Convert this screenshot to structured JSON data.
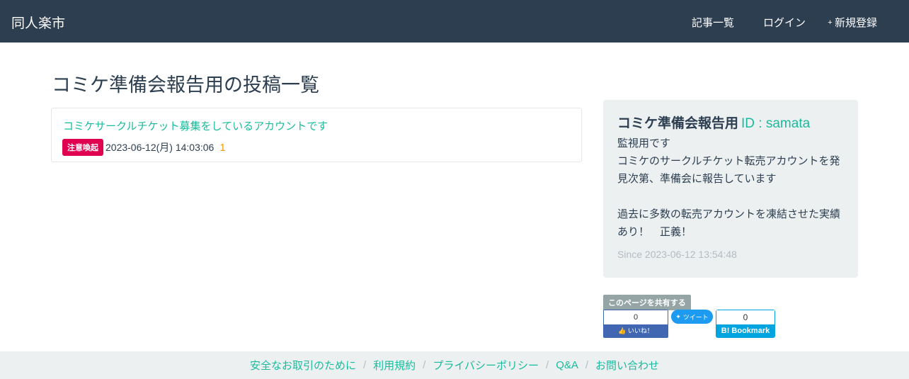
{
  "navbar": {
    "brand": "同人楽市",
    "items": [
      {
        "icon": "",
        "label": "記事一覧"
      },
      {
        "icon": "",
        "label": "ログイン"
      },
      {
        "icon": "+",
        "label": "新規登録"
      }
    ]
  },
  "main": {
    "title": "コミケ準備会報告用の投稿一覧",
    "posts": [
      {
        "title": "コミケサークルチケット募集をしているアカウントです",
        "badge": "注意喚起",
        "datetime": "2023-06-12(月) 14:03:06",
        "comment_icon": "",
        "comment_count": "1"
      }
    ]
  },
  "profile": {
    "icon": "",
    "name": "コミケ準備会報告用",
    "id": "ID : samata",
    "bio": "監視用です\nコミケのサークルチケット転売アカウントを発見次第、準備会に報告しています\n\n過去に多数の転売アカウントを凍結させた実績あり！　正義！",
    "since_icon": "",
    "since": "Since 2023-06-12 13:54:48"
  },
  "share": {
    "label": "このページを共有する",
    "facebook": {
      "count": "0",
      "label": "いいね！"
    },
    "twitter": {
      "label": "ツイート"
    },
    "hatena": {
      "count": "0",
      "label": "B! Bookmark"
    }
  },
  "footer": {
    "links": [
      "安全なお取引のために",
      "利用規約",
      "プライバシーポリシー",
      "Q&A",
      "お問い合わせ"
    ],
    "separator": "/"
  },
  "colors": {
    "navbar": "#2c3e50",
    "accent": "#18bc9c",
    "badge": "#e00050",
    "comment": "#f39c12",
    "panel": "#ecf0f1"
  }
}
